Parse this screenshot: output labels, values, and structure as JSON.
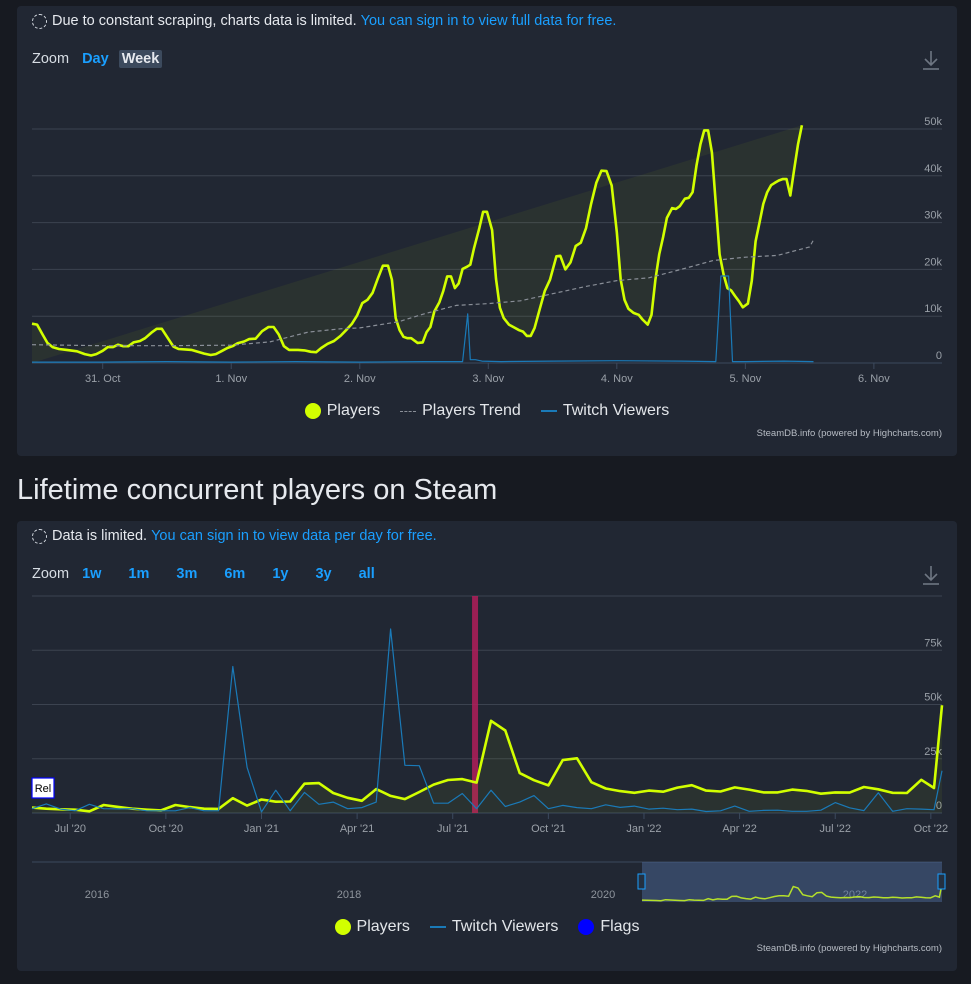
{
  "panel1": {
    "notice_text": "Due to constant scraping, charts data is limited.",
    "notice_link": "You can sign in to view full data for free.",
    "zoom_label": "Zoom",
    "zoom_buttons": [
      {
        "label": "Day",
        "active": false
      },
      {
        "label": "Week",
        "active": true
      }
    ],
    "credits": "SteamDB.info (powered by Highcharts.com)"
  },
  "section_title": "Lifetime concurrent players on Steam",
  "panel2": {
    "notice_text": "Data is limited.",
    "notice_link": "You can sign in to view data per day for free.",
    "zoom_label": "Zoom",
    "zoom_buttons": [
      {
        "label": "1w"
      },
      {
        "label": "1m"
      },
      {
        "label": "3m"
      },
      {
        "label": "6m"
      },
      {
        "label": "1y"
      },
      {
        "label": "3y"
      },
      {
        "label": "all"
      }
    ],
    "flag_label": "Rel",
    "credits": "SteamDB.info (powered by Highcharts.com)"
  },
  "colors": {
    "players": "#d2ff00",
    "trend": "#8a8f98",
    "twitch": "#1a7ab8",
    "flags": "#0000ff",
    "link": "#1a9fff",
    "flag_band": "#b01e5a"
  },
  "chart_data": [
    {
      "type": "line",
      "title": "",
      "x_unit": "days since 30 Oct 00:00",
      "xlim": [
        0.45,
        7.53
      ],
      "ylim": [
        0,
        50000
      ],
      "yticks": [
        0,
        10000,
        20000,
        30000,
        40000,
        50000
      ],
      "ytick_labels": [
        "0",
        "10k",
        "20k",
        "30k",
        "40k",
        "50k"
      ],
      "xticks": [
        1,
        2,
        3,
        4,
        5,
        6,
        7
      ],
      "xtick_labels": [
        "31. Oct",
        "1. Nov",
        "2. Nov",
        "3. Nov",
        "4. Nov",
        "5. Nov",
        "6. Nov"
      ],
      "grid": true,
      "legend": "bottom-center",
      "legend_labels": [
        "Players",
        "Players Trend",
        "Twitch Viewers"
      ],
      "series": [
        {
          "name": "Players",
          "x": [
            0.45,
            0.49,
            0.53,
            0.57,
            0.61,
            0.66,
            0.72,
            0.8,
            0.86,
            0.91,
            0.95,
            1.0,
            1.04,
            1.08,
            1.12,
            1.16,
            1.2,
            1.24,
            1.29,
            1.33,
            1.38,
            1.42,
            1.46,
            1.5,
            1.55,
            1.59,
            1.64,
            1.69,
            1.74,
            1.79,
            1.84,
            1.88,
            1.93,
            1.97,
            2.01,
            2.05,
            2.1,
            2.14,
            2.19,
            2.24,
            2.29,
            2.33,
            2.37,
            2.41,
            2.45,
            2.49,
            2.52,
            2.57,
            2.62,
            2.66,
            2.7,
            2.75,
            2.8,
            2.85,
            2.9,
            2.94,
            2.98,
            3.02,
            3.06,
            3.1,
            3.14,
            3.18,
            3.22,
            3.25,
            3.28,
            3.31,
            3.34,
            3.37,
            3.4,
            3.45,
            3.49,
            3.52,
            3.55,
            3.58,
            3.62,
            3.65,
            3.68,
            3.71,
            3.74,
            3.77,
            3.8,
            3.83,
            3.86,
            3.89,
            3.93,
            3.96,
            3.99,
            4.03,
            4.06,
            4.09,
            4.12,
            4.16,
            4.2,
            4.24,
            4.27,
            4.3,
            4.33,
            4.36,
            4.4,
            4.44,
            4.48,
            4.53,
            4.56,
            4.6,
            4.64,
            4.68,
            4.72,
            4.76,
            4.8,
            4.84,
            4.88,
            4.92,
            4.96,
            5.0,
            5.03,
            5.06,
            5.09,
            5.13,
            5.17,
            5.2,
            5.24,
            5.27,
            5.3,
            5.33,
            5.36,
            5.39,
            5.43,
            5.46,
            5.49,
            5.53,
            5.56,
            5.59,
            5.62,
            5.65,
            5.68,
            5.71,
            5.74,
            5.77,
            5.8,
            5.83,
            5.86,
            5.89,
            5.92,
            5.95,
            5.98,
            6.02,
            6.05,
            6.08,
            6.11,
            6.14,
            6.17,
            6.2,
            6.23,
            6.26,
            6.29,
            6.32,
            6.35,
            6.38,
            6.41,
            6.44,
            6.47,
            6.5,
            6.53
          ],
          "y": [
            8400,
            8200,
            6200,
            4300,
            3400,
            3000,
            2800,
            2500,
            1900,
            1600,
            1900,
            2600,
            3400,
            3400,
            3900,
            3600,
            3600,
            4400,
            4700,
            5300,
            6500,
            7300,
            7300,
            5600,
            3500,
            3000,
            2900,
            2800,
            2400,
            2000,
            1700,
            1900,
            2600,
            3200,
            3600,
            4200,
            4600,
            5100,
            5200,
            6800,
            7700,
            7700,
            6100,
            3600,
            2800,
            2800,
            2800,
            2700,
            2400,
            2300,
            3200,
            4100,
            4700,
            5800,
            7200,
            8400,
            10200,
            12800,
            13500,
            15000,
            18000,
            20800,
            20800,
            17800,
            9600,
            7000,
            5600,
            5300,
            5300,
            4300,
            4400,
            6600,
            7700,
            11000,
            13000,
            15400,
            18500,
            18500,
            16000,
            17000,
            20100,
            20500,
            21000,
            24600,
            28800,
            32300,
            32300,
            28400,
            18000,
            11800,
            9600,
            8200,
            7600,
            7000,
            6700,
            5800,
            5800,
            7500,
            11500,
            15400,
            17800,
            22800,
            22900,
            20000,
            21500,
            25000,
            25700,
            28800,
            34000,
            38500,
            41100,
            41000,
            37900,
            28000,
            17800,
            13500,
            11600,
            10700,
            10300,
            9300,
            8200,
            10300,
            17800,
            23200,
            26900,
            31000,
            33100,
            32900,
            33500,
            35100,
            35300,
            36500,
            42200,
            46700,
            49700,
            49700,
            45000,
            34000,
            23200,
            19000,
            16000,
            15500,
            14300,
            13200,
            11900,
            12700,
            17600,
            26000,
            30000,
            34000,
            36500,
            38000,
            38500,
            39000,
            39300,
            39300,
            35800,
            41400,
            46700,
            50800
          ],
          "color": "#d2ff00"
        },
        {
          "name": "Players Trend",
          "x": [
            0.45,
            1.0,
            1.5,
            2.0,
            2.3,
            2.6,
            2.85,
            3.0,
            3.3,
            3.5,
            3.75,
            4.0,
            4.25,
            4.5,
            4.75,
            5.0,
            5.25,
            5.5,
            5.75,
            6.0,
            6.25,
            6.5,
            6.53
          ],
          "y": [
            3900,
            3700,
            3700,
            3800,
            4500,
            6600,
            7300,
            7500,
            8800,
            10500,
            12300,
            12700,
            13300,
            14800,
            16300,
            17600,
            18200,
            20000,
            21900,
            22600,
            23000,
            24800,
            26300
          ],
          "color": "#8a8f98"
        },
        {
          "name": "Twitch Viewers",
          "x": [
            0.45,
            1.0,
            1.5,
            2.0,
            2.5,
            3.0,
            3.5,
            3.8,
            3.84,
            3.86,
            3.9,
            3.95,
            4.1,
            4.5,
            5.0,
            5.5,
            5.77,
            5.81,
            5.87,
            5.9,
            5.92,
            6.0,
            6.3,
            6.53
          ],
          "y": [
            200,
            200,
            300,
            200,
            300,
            200,
            300,
            300,
            10500,
            700,
            700,
            400,
            300,
            400,
            500,
            400,
            300,
            18600,
            18600,
            300,
            300,
            300,
            400,
            300
          ],
          "color": "#1a7ab8"
        }
      ]
    },
    {
      "type": "line",
      "title": "Lifetime concurrent players on Steam",
      "x_unit": "months since Jan 2020",
      "xlim": [
        4.8,
        33.35
      ],
      "ylim": [
        0,
        100000
      ],
      "yticks": [
        0,
        25000,
        50000,
        75000,
        100000
      ],
      "ytick_labels": [
        "0",
        "25k",
        "50k",
        "75k",
        ""
      ],
      "xticks": [
        6,
        9,
        12,
        15,
        18,
        21,
        24,
        27,
        30,
        33
      ],
      "xtick_labels": [
        "Jul '20",
        "Oct '20",
        "Jan '21",
        "Apr '21",
        "Jul '21",
        "Oct '21",
        "Jan '22",
        "Apr '22",
        "Jul '22",
        "Oct '22"
      ],
      "grid": true,
      "legend": "bottom-center",
      "legend_labels": [
        "Players",
        "Twitch Viewers",
        "Flags"
      ],
      "flags": [
        {
          "x": 4.8,
          "label": "Rel"
        }
      ],
      "plot_band": {
        "x": 18.7,
        "color": "#b01e5a"
      },
      "series": [
        {
          "name": "Players",
          "x": [
            4.8,
            5.25,
            5.7,
            6.15,
            6.6,
            7.05,
            7.5,
            7.95,
            8.4,
            8.85,
            9.3,
            9.75,
            10.2,
            10.65,
            11.1,
            11.55,
            12.0,
            12.45,
            12.9,
            13.35,
            13.8,
            14.25,
            14.7,
            15.15,
            15.6,
            16.05,
            16.5,
            16.95,
            17.4,
            17.85,
            18.3,
            18.75,
            19.2,
            19.65,
            20.1,
            20.55,
            21.0,
            21.45,
            21.9,
            22.35,
            22.8,
            23.25,
            23.7,
            24.15,
            24.6,
            25.05,
            25.5,
            25.95,
            26.4,
            26.85,
            27.3,
            27.75,
            28.2,
            28.65,
            29.1,
            29.55,
            30.0,
            30.45,
            30.9,
            31.35,
            31.8,
            32.25,
            32.7,
            33.1,
            33.35
          ],
          "y": [
            2500,
            2000,
            1700,
            1500,
            800,
            3700,
            2800,
            2000,
            1500,
            1200,
            3700,
            2700,
            2000,
            1900,
            6800,
            3400,
            6200,
            5200,
            5300,
            13500,
            13800,
            9200,
            7000,
            5600,
            11000,
            7900,
            6400,
            9700,
            13100,
            15200,
            15600,
            14000,
            42500,
            38000,
            18400,
            15100,
            12700,
            24400,
            25200,
            14200,
            11300,
            10100,
            9300,
            10300,
            9800,
            11700,
            12800,
            10300,
            9900,
            11800,
            10800,
            9500,
            9500,
            10800,
            10200,
            8900,
            9500,
            9400,
            12000,
            10900,
            9300,
            9200,
            15300,
            11500,
            49700
          ],
          "color": "#d2ff00"
        },
        {
          "name": "Twitch Viewers",
          "x": [
            4.8,
            5.25,
            5.7,
            6.15,
            6.6,
            7.05,
            7.5,
            7.95,
            8.4,
            8.85,
            9.3,
            9.75,
            10.2,
            10.65,
            11.1,
            11.55,
            12.0,
            12.45,
            12.9,
            13.35,
            13.8,
            14.25,
            14.7,
            15.15,
            15.6,
            16.05,
            16.5,
            16.95,
            17.4,
            17.85,
            18.3,
            18.75,
            19.2,
            19.65,
            20.1,
            20.55,
            21.0,
            21.45,
            21.9,
            22.35,
            22.8,
            23.25,
            23.7,
            24.15,
            24.6,
            25.05,
            25.5,
            25.95,
            26.4,
            26.85,
            27.3,
            27.75,
            28.2,
            28.65,
            29.1,
            29.55,
            30.0,
            30.45,
            30.9,
            31.35,
            31.8,
            32.25,
            32.7,
            33.1,
            33.35
          ],
          "y": [
            2000,
            4200,
            1800,
            1000,
            4000,
            2000,
            1900,
            2000,
            1000,
            1000,
            1000,
            2500,
            1000,
            1000,
            67500,
            21000,
            500,
            10500,
            1000,
            9500,
            4000,
            5000,
            2000,
            2500,
            5000,
            84800,
            22000,
            21800,
            4500,
            4500,
            9000,
            2000,
            10500,
            3000,
            5000,
            8000,
            2000,
            3500,
            2500,
            2000,
            3800,
            2600,
            3200,
            1800,
            2200,
            1500,
            1800,
            700,
            1000,
            3200,
            800,
            1200,
            1300,
            800,
            800,
            1300,
            4800,
            2400,
            1100,
            9300,
            800,
            2000,
            1800,
            1500,
            19500
          ],
          "color": "#1a7ab8"
        }
      ]
    }
  ],
  "navigator": {
    "year_labels": [
      "2016",
      "2018",
      "2020",
      "2022"
    ]
  }
}
